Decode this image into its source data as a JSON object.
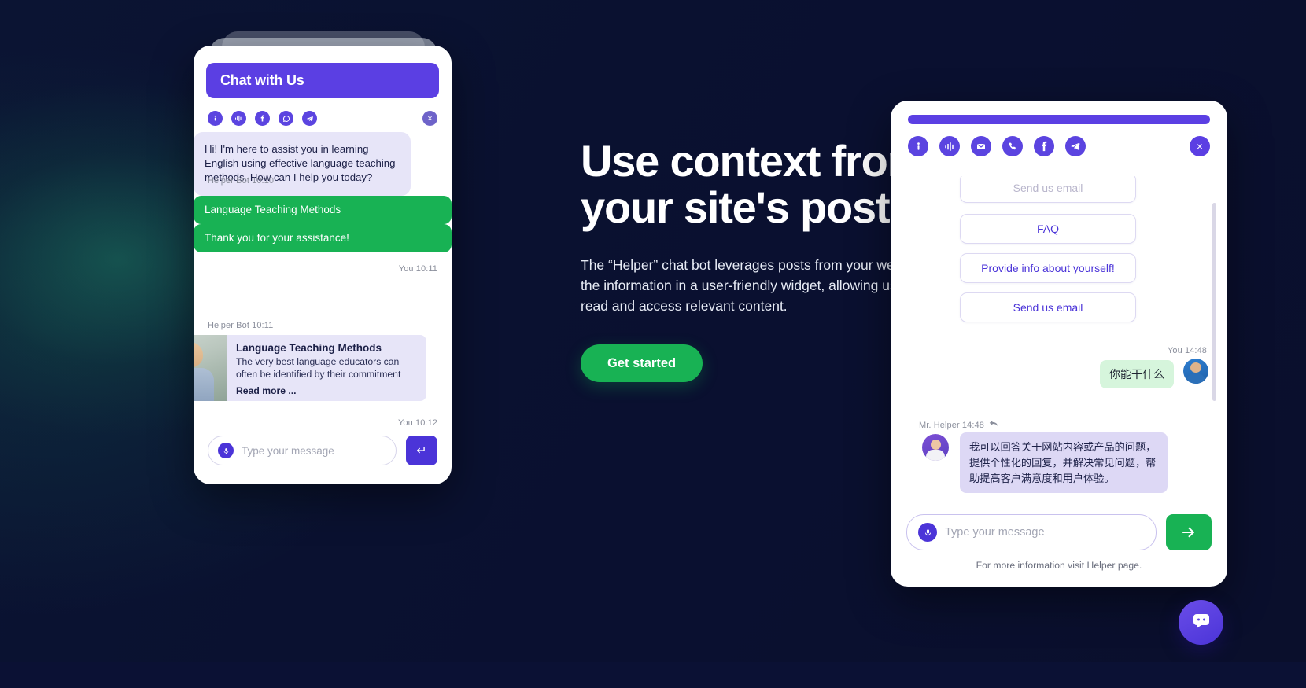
{
  "hero": {
    "heading": "Use context from\nyour site's posts",
    "paragraph": "The “Helper” chat bot leverages posts from your website and presents the information in a user-friendly widget, allowing users to conveniently read and access relevant content.",
    "cta_label": "Get started"
  },
  "left_widget": {
    "title": "Chat with Us",
    "close_label": "×",
    "icons": [
      {
        "name": "info-icon",
        "glyph": "i"
      },
      {
        "name": "voice-waveform-icon",
        "glyph": "~"
      },
      {
        "name": "facebook-icon",
        "glyph": "f"
      },
      {
        "name": "whatsapp-icon",
        "glyph": "c"
      },
      {
        "name": "telegram-icon",
        "glyph": "t"
      }
    ],
    "messages": [
      {
        "sender": "Helper Bot",
        "time": "10:10",
        "text": "Hi! I'm here to assist you in learning English using effective language teaching methods. How can I help you today?",
        "side": "bot"
      },
      {
        "sender": "You",
        "time": "10:11",
        "text": "Language Teaching Methods",
        "side": "me"
      },
      {
        "sender": "Helper Bot",
        "time": "10:11",
        "side": "card"
      },
      {
        "sender": "You",
        "time": "10:12",
        "text": "Thank you for your assistance!",
        "side": "me"
      }
    ],
    "meta_labels": {
      "bot_1": "Helper Bot 10:10",
      "you_1": "You 10:11",
      "bot_2": "Helper Bot 10:11",
      "you_2": "You 10:12"
    },
    "card": {
      "title": "Language Teaching Methods",
      "description": "The very best language educators can often be identified by their commitment",
      "read_more": "Read more ..."
    },
    "composer": {
      "placeholder": "Type your message",
      "send_glyph": "↵"
    }
  },
  "right_widget": {
    "close_label": "×",
    "icons": [
      {
        "name": "info-icon",
        "glyph": "i"
      },
      {
        "name": "voice-waveform-icon",
        "glyph": "~"
      },
      {
        "name": "email-icon",
        "glyph": "m"
      },
      {
        "name": "phone-icon",
        "glyph": "p"
      },
      {
        "name": "facebook-icon",
        "glyph": "f"
      },
      {
        "name": "telegram-icon",
        "glyph": "t"
      }
    ],
    "options": [
      "Send us email",
      "FAQ",
      "Provide info about yourself!",
      "Send us email"
    ],
    "you_meta": "You  14:48",
    "you_message": "你能干什么",
    "helper_meta": "Mr. Helper 14:48",
    "helper_message": "我可以回答关于网站内容或产品的问题，提供个性化的回复，并解决常见问题，帮助提高客户满意度和用户体验。",
    "composer": {
      "placeholder": "Type your message",
      "send_glyph": "→"
    },
    "footnote": "For more information visit Helper page."
  },
  "launcher": {
    "name": "chat-launcher"
  },
  "colors": {
    "brand_purple": "#5b3fe3",
    "accent_green": "#18b254",
    "page_bg": "#0a1232",
    "bot_bubble": "#e7e5f8",
    "me_bubble_green": "#d6f5dc"
  }
}
